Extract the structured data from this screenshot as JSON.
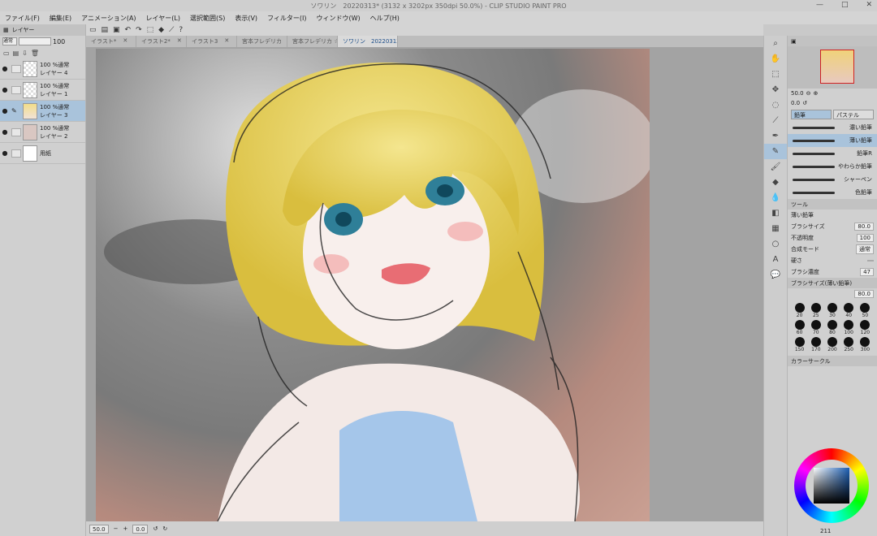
{
  "window": {
    "title": "ソワリン　20220313* (3132 x 3202px 350dpi 50.0%) - CLIP STUDIO PAINT PRO",
    "controls": [
      "—",
      "□",
      "✕"
    ]
  },
  "menu": [
    "ファイル(F)",
    "編集(E)",
    "アニメーション(A)",
    "レイヤー(L)",
    "選択範囲(S)",
    "表示(V)",
    "フィルター(I)",
    "ウィンドウ(W)",
    "ヘルプ(H)"
  ],
  "layers_panel": {
    "tab_label": "レイヤー",
    "blend_mode": "通常",
    "opacity": "100",
    "layers": [
      {
        "name": "レイヤー 4",
        "info": "100 %通常"
      },
      {
        "name": "レイヤー 1",
        "info": "100 %通常"
      },
      {
        "name": "レイヤー 3",
        "info": "100 %通常"
      },
      {
        "name": "レイヤー 2",
        "info": "100 %通常"
      },
      {
        "name": "用紙",
        "info": ""
      }
    ]
  },
  "tabs": [
    "イラスト*",
    "イラスト2*",
    "イラスト3",
    "宮本フレデリカ",
    "宮本フレデリカ ☆",
    "ソワリン　20220313*"
  ],
  "status": {
    "zoom": "50.0",
    "angle": "0.0"
  },
  "navigator": {
    "zoom": "50.0",
    "angle": "0.0"
  },
  "subtool": {
    "tabs": [
      "鉛筆",
      "パステル"
    ],
    "brushes": [
      "濃い鉛筆",
      "薄い鉛筆",
      "鉛筆R",
      "やわらか鉛筆",
      "シャーペン",
      "色鉛筆"
    ]
  },
  "tool_property": {
    "tab_label": "ツール",
    "brush_name": "薄い鉛筆",
    "rows": [
      {
        "label": "ブラシサイズ",
        "value": "80.0"
      },
      {
        "label": "不透明度",
        "value": "100"
      },
      {
        "label": "合成モード",
        "value": "通常"
      },
      {
        "label": "硬さ",
        "value": ""
      },
      {
        "label": "ブラシ濃度",
        "value": "47"
      }
    ]
  },
  "brush_size": {
    "tab_label": "ブラシサイズ(薄い鉛筆)",
    "current": "80.0",
    "sizes": [
      "20",
      "25",
      "30",
      "40",
      "50",
      "60",
      "70",
      "80",
      "100",
      "120",
      "150",
      "170",
      "200",
      "250",
      "300"
    ]
  },
  "color": {
    "tab_label": "カラーサークル",
    "readout": "211"
  }
}
